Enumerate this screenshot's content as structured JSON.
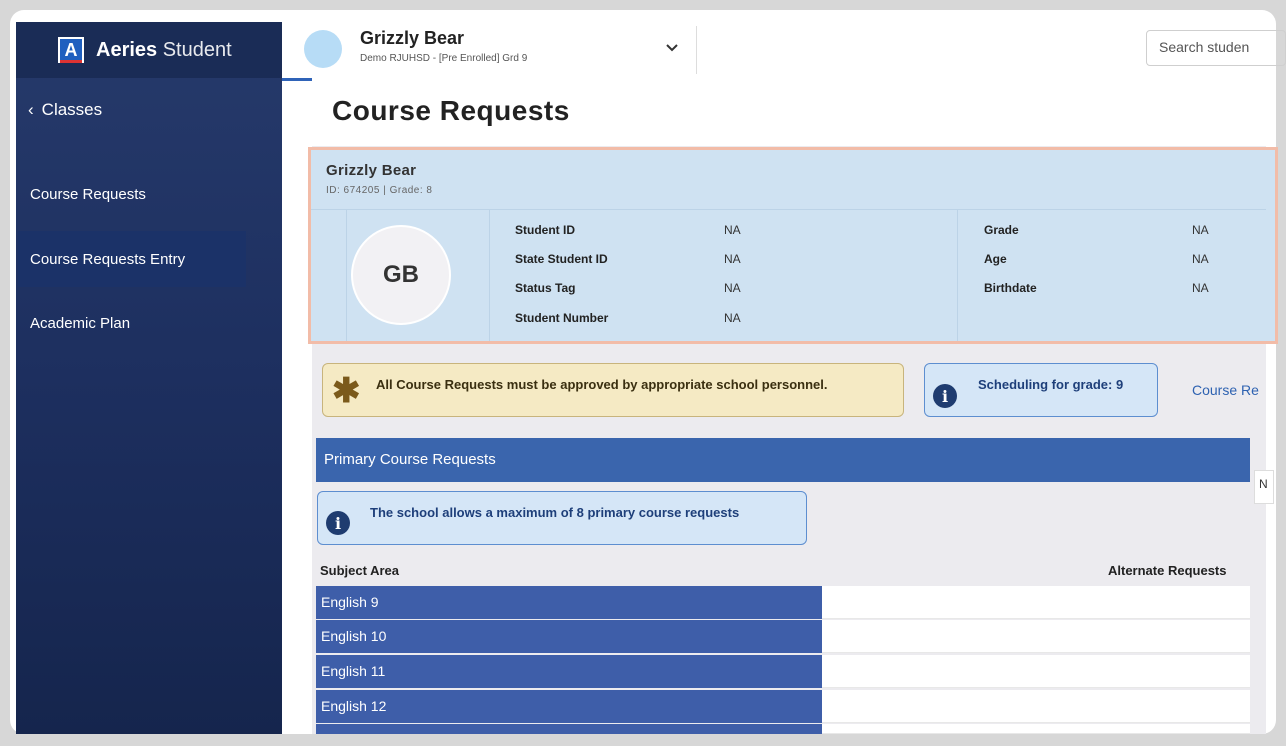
{
  "app": {
    "brand_bold": "Aeries",
    "brand_light": "Student",
    "logo_letter": "A"
  },
  "sidebar": {
    "back_label": "Classes",
    "items": [
      {
        "label": "Course Requests",
        "active": false
      },
      {
        "label": "Course Requests Entry",
        "active": true
      },
      {
        "label": "Academic Plan",
        "active": false
      }
    ]
  },
  "header": {
    "student_name": "Grizzly Bear",
    "student_sub": "Demo RJUHSD - [Pre Enrolled] Grd 9",
    "search_placeholder": "Search studen"
  },
  "page": {
    "title": "Course Requests"
  },
  "student_card": {
    "name": "Grizzly Bear",
    "id_line": "ID: 674205 |  Grade: 8",
    "initials": "GB",
    "left_fields": [
      {
        "label": "Student ID",
        "value": "NA"
      },
      {
        "label": "State Student ID",
        "value": "NA"
      },
      {
        "label": "Status Tag",
        "value": "NA"
      },
      {
        "label": "Student Number",
        "value": "NA"
      }
    ],
    "right_fields": [
      {
        "label": "Grade",
        "value": "NA"
      },
      {
        "label": "Age",
        "value": "NA"
      },
      {
        "label": "Birthdate",
        "value": "NA"
      }
    ]
  },
  "notices": {
    "approval": "All Course Requests must be approved by appropriate school personnel.",
    "scheduling": "Scheduling for grade: 9",
    "course_link": "Course Re",
    "max_requests": "The school allows a maximum of 8 primary course requests"
  },
  "primary": {
    "header": "Primary Course Requests",
    "side_box_text": "N",
    "col_subject": "Subject Area",
    "col_alternate": "Alternate Requests",
    "rows": [
      "English 9",
      "English 10",
      "English 11",
      "English 12"
    ]
  },
  "colors": {
    "sidebar": "#1d2f5f",
    "accent_blue": "#3a65ad",
    "card_bg": "#cfe2f2",
    "card_border": "#f2bca8",
    "notice_yellow": "#f5eac4"
  }
}
